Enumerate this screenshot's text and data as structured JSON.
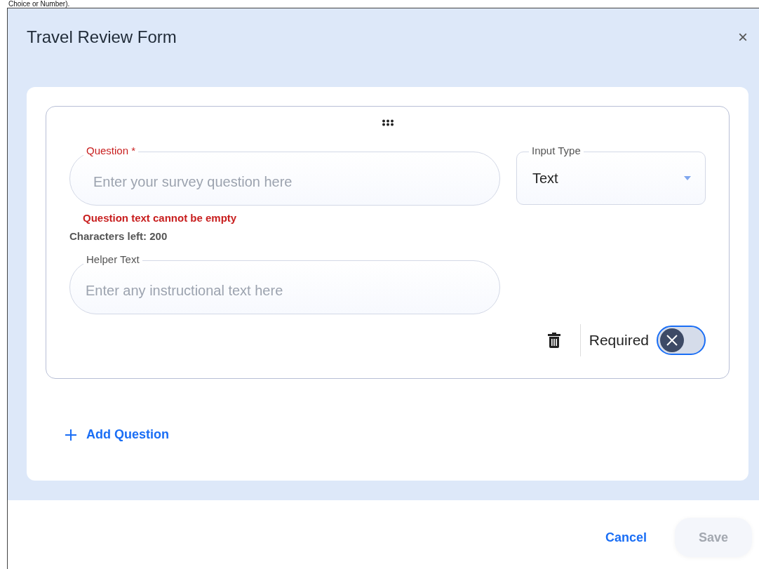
{
  "background_text": "Choice or Number).",
  "dialog": {
    "title": "Travel Review Form",
    "close": "×"
  },
  "question_card": {
    "question_field": {
      "label": "Question",
      "required_mark": "*",
      "placeholder": "Enter your survey question here",
      "error": true
    },
    "error_message": "Question text cannot be empty",
    "characters_left": "Characters left: 200",
    "input_type": {
      "label": "Input Type",
      "value": "Text"
    },
    "helper_field": {
      "label": "Helper Text",
      "placeholder": "Enter any instructional text here"
    },
    "required_toggle": {
      "label": "Required",
      "on": false
    }
  },
  "add_question": "Add Question",
  "footer": {
    "buttons": [
      {
        "label": "Cancel",
        "kind": "text",
        "disabled": false
      },
      {
        "label": "Save",
        "kind": "filled",
        "disabled": true
      }
    ]
  }
}
